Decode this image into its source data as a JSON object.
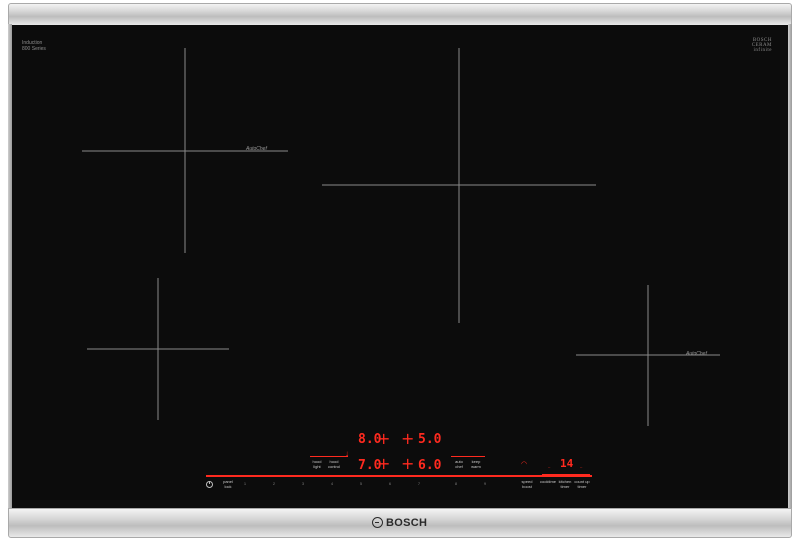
{
  "brand": {
    "top_left_line1": "Induction",
    "top_left_line2": "800 Series",
    "top_right_line1": "BOSCH",
    "top_right_line2": "CERAM",
    "top_right_line3": "infinite",
    "logo_text": "BOSCH"
  },
  "zones": [
    {
      "id": "rear-left",
      "autochef": "AutoChef"
    },
    {
      "id": "center",
      "autochef": ""
    },
    {
      "id": "front-left",
      "autochef": ""
    },
    {
      "id": "front-right",
      "autochef": "AutoChef"
    }
  ],
  "displays": {
    "rear_left": "8.0",
    "rear_right": "5.0",
    "front_left": "7.0",
    "front_right": "6.0",
    "timer": "14"
  },
  "controls": {
    "power_label": "",
    "panel_lock": "panel lock",
    "hood_light": "hood light",
    "hood_control": "hood control",
    "auto_chef": "auto chef",
    "keep_warm": "keep warm",
    "speed_boost": "speed boost",
    "cooktime": "cooktime",
    "kitchen_timer": "kitchen timer",
    "count_up_timer": "count up timer"
  },
  "slider": {
    "numbers": [
      "1",
      "2",
      "3",
      "4",
      "5",
      "6",
      "7",
      "8",
      "9"
    ]
  },
  "colors": {
    "glass": "#0c0c0c",
    "display_red": "#ff2a1f",
    "frame": "#c8c8c8"
  }
}
